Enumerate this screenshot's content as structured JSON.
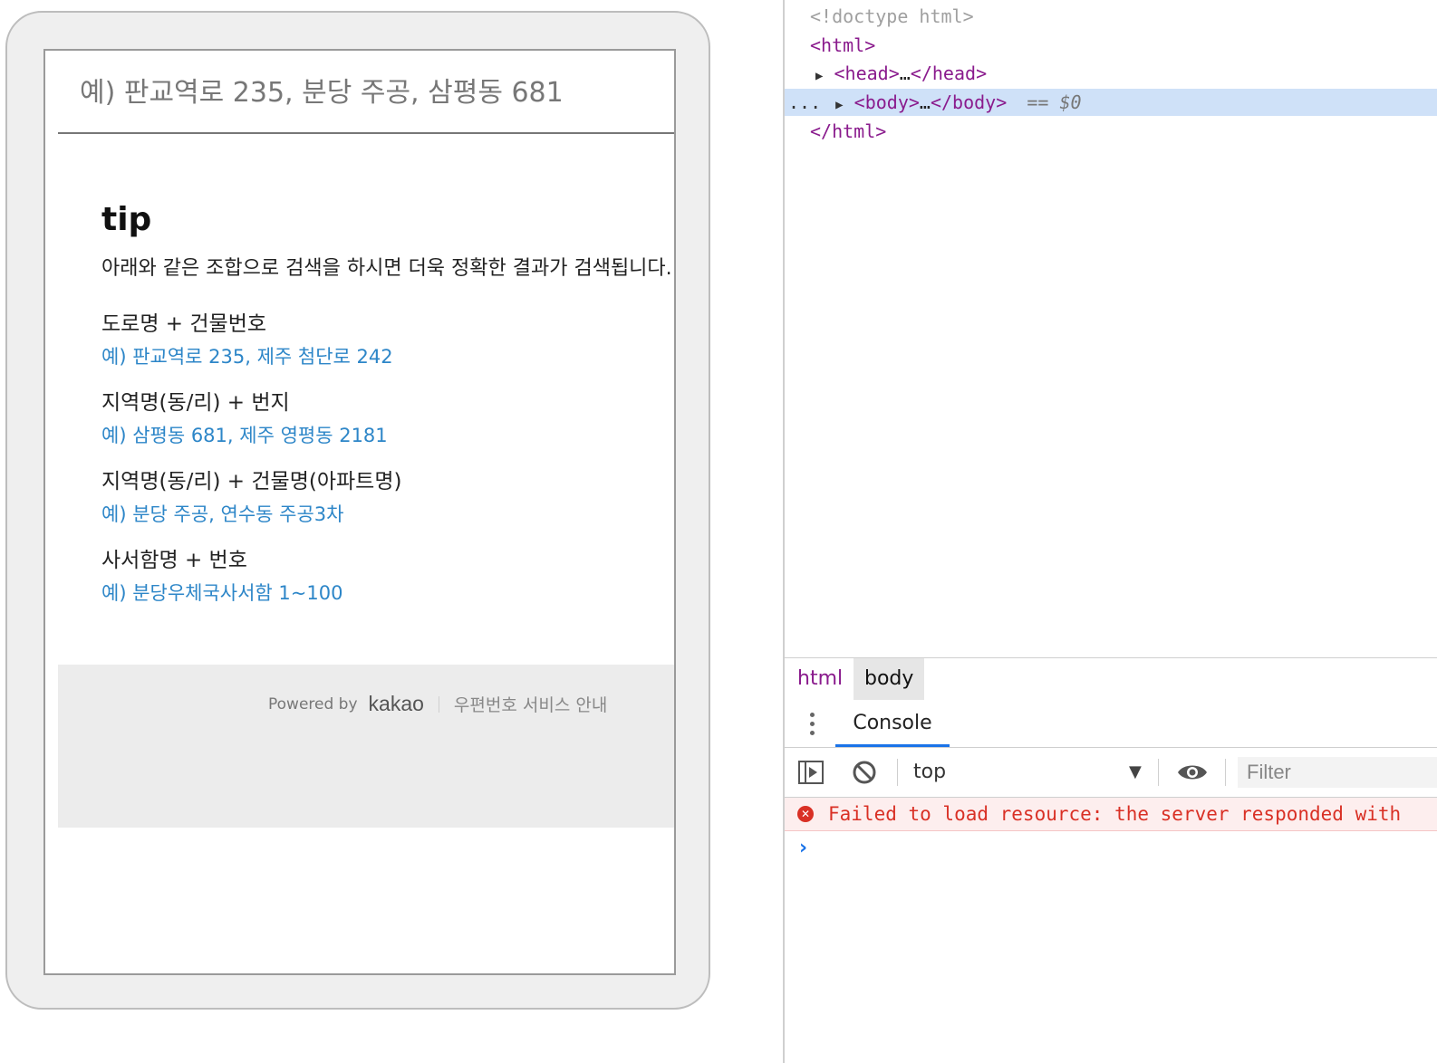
{
  "address_search": {
    "search_placeholder": "예) 판교역로 235, 분당 주공, 삼평동 681",
    "tip_title": "tip",
    "tip_description": "아래와 같은 조합으로 검색을 하시면 더욱 정확한 결과가 검색됩니다.",
    "tips": [
      {
        "label": "도로명 + 건물번호",
        "example": "예) 판교역로 235,  제주 첨단로 242"
      },
      {
        "label": "지역명(동/리) + 번지",
        "example": "예) 삼평동 681,  제주 영평동 2181"
      },
      {
        "label": "지역명(동/리) + 건물명(아파트명)",
        "example": "예) 분당 주공,  연수동 주공3차"
      },
      {
        "label": "사서함명 + 번호",
        "example": "예) 분당우체국사서함 1~100"
      }
    ],
    "footer": {
      "powered_by": "Powered by",
      "brand": "kakao",
      "service_link": "우편번호 서비스 안내"
    }
  },
  "devtools": {
    "dom": {
      "doctype": "<!doctype html>",
      "html_open": "html",
      "head_tag": "head",
      "head_close": "/head",
      "body_tag": "body",
      "body_close": "/body",
      "selected_marker": "== $0",
      "html_close": "/html",
      "ellipsis_row": "...",
      "collapsed": "…"
    },
    "breadcrumbs": [
      "html",
      "body"
    ],
    "console_tab": "Console",
    "context": "top",
    "filter_placeholder": "Filter",
    "error_message": "Failed to load resource: the server responded with",
    "colors": {
      "accent": "#1a73e8",
      "error": "#d93025",
      "tag": "#8a1b8d",
      "example_link": "#2d86c8"
    }
  }
}
